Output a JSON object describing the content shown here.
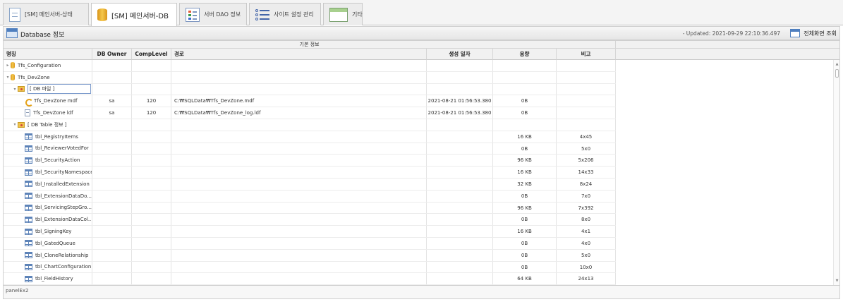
{
  "tabs": [
    {
      "label": "[SM] 메인서버-상태",
      "icon": "document-icon",
      "active": false
    },
    {
      "label": "[SM] 메인서버-DB",
      "icon": "database-icon",
      "active": true
    },
    {
      "label": "서버 DAO 정보",
      "icon": "list-icon",
      "active": false
    },
    {
      "label": "사이트 설정 관리",
      "icon": "settings-list-icon",
      "active": false
    },
    {
      "label": "기타",
      "icon": "window-icon",
      "active": false
    }
  ],
  "header": {
    "title": "Database 정보",
    "updated": "- Updated: 2021-09-29 22:10:36.497",
    "fullscreen_label": "전체화면 조회"
  },
  "grid": {
    "band_label": "기본 정보",
    "columns": {
      "name": "명칭",
      "owner": "DB Owner",
      "comp": "CompLevel",
      "path": "경로",
      "created": "생성 일자",
      "size": "용량",
      "note": "비고"
    },
    "rows": [
      {
        "indent": 0,
        "toggle": "▸",
        "icon": "db",
        "name": "Tfs_Configuration",
        "owner": "",
        "comp": "",
        "path": "",
        "created": "",
        "size": "",
        "note": ""
      },
      {
        "indent": 0,
        "toggle": "▾",
        "icon": "db",
        "name": "Tfs_DevZone",
        "owner": "",
        "comp": "",
        "path": "",
        "created": "",
        "size": "",
        "note": ""
      },
      {
        "indent": 1,
        "toggle": "▾",
        "icon": "folder",
        "name": "[ DB 파일 ]",
        "owner": "",
        "comp": "",
        "path": "",
        "created": "",
        "size": "",
        "note": "",
        "selected": true
      },
      {
        "indent": 2,
        "toggle": "",
        "icon": "mdf",
        "name": "Tfs_DevZone mdf",
        "owner": "sa",
        "comp": "120",
        "path": "C:₩SQLData₩Tfs_DevZone.mdf",
        "created": "2021-08-21 01:56:53.380",
        "size": "0B",
        "note": ""
      },
      {
        "indent": 2,
        "toggle": "",
        "icon": "ldf",
        "name": "Tfs_DevZone ldf",
        "owner": "sa",
        "comp": "120",
        "path": "C:₩SQLData₩Tfs_DevZone_log.ldf",
        "created": "2021-08-21 01:56:53.380",
        "size": "0B",
        "note": ""
      },
      {
        "indent": 1,
        "toggle": "▾",
        "icon": "folder",
        "name": "[ DB Table 정보 ]",
        "owner": "",
        "comp": "",
        "path": "",
        "created": "",
        "size": "",
        "note": ""
      },
      {
        "indent": 2,
        "toggle": "",
        "icon": "tbl",
        "name": "tbl_RegistryItems",
        "owner": "",
        "comp": "",
        "path": "",
        "created": "",
        "size": "16 KB",
        "note": "4x45"
      },
      {
        "indent": 2,
        "toggle": "",
        "icon": "tbl",
        "name": "tbl_ReviewerVotedFor",
        "owner": "",
        "comp": "",
        "path": "",
        "created": "",
        "size": "0B",
        "note": "5x0"
      },
      {
        "indent": 2,
        "toggle": "",
        "icon": "tbl",
        "name": "tbl_SecurityAction",
        "owner": "",
        "comp": "",
        "path": "",
        "created": "",
        "size": "96 KB",
        "note": "5x206"
      },
      {
        "indent": 2,
        "toggle": "",
        "icon": "tbl",
        "name": "tbl_SecurityNamespace",
        "owner": "",
        "comp": "",
        "path": "",
        "created": "",
        "size": "16 KB",
        "note": "14x33"
      },
      {
        "indent": 2,
        "toggle": "",
        "icon": "tbl",
        "name": "tbl_InstalledExtension",
        "owner": "",
        "comp": "",
        "path": "",
        "created": "",
        "size": "32 KB",
        "note": "8x24"
      },
      {
        "indent": 2,
        "toggle": "",
        "icon": "tbl",
        "name": "tbl_ExtensionDataDo...",
        "owner": "",
        "comp": "",
        "path": "",
        "created": "",
        "size": "0B",
        "note": "7x0"
      },
      {
        "indent": 2,
        "toggle": "",
        "icon": "tbl",
        "name": "tbl_ServicingStepGro...",
        "owner": "",
        "comp": "",
        "path": "",
        "created": "",
        "size": "96 KB",
        "note": "7x392"
      },
      {
        "indent": 2,
        "toggle": "",
        "icon": "tbl",
        "name": "tbl_ExtensionDataCol...",
        "owner": "",
        "comp": "",
        "path": "",
        "created": "",
        "size": "0B",
        "note": "8x0"
      },
      {
        "indent": 2,
        "toggle": "",
        "icon": "tbl",
        "name": "tbl_SigningKey",
        "owner": "",
        "comp": "",
        "path": "",
        "created": "",
        "size": "16 KB",
        "note": "4x1"
      },
      {
        "indent": 2,
        "toggle": "",
        "icon": "tbl",
        "name": "tbl_GatedQueue",
        "owner": "",
        "comp": "",
        "path": "",
        "created": "",
        "size": "0B",
        "note": "4x0"
      },
      {
        "indent": 2,
        "toggle": "",
        "icon": "tbl",
        "name": "tbl_CloneRelationship",
        "owner": "",
        "comp": "",
        "path": "",
        "created": "",
        "size": "0B",
        "note": "5x0"
      },
      {
        "indent": 2,
        "toggle": "",
        "icon": "tbl",
        "name": "tbl_ChartConfiguration",
        "owner": "",
        "comp": "",
        "path": "",
        "created": "",
        "size": "0B",
        "note": "10x0"
      },
      {
        "indent": 2,
        "toggle": "",
        "icon": "tbl",
        "name": "tbl_FieldHistory",
        "owner": "",
        "comp": "",
        "path": "",
        "created": "",
        "size": "64 KB",
        "note": "24x13"
      }
    ]
  },
  "footer": {
    "label": "panelEx2"
  }
}
